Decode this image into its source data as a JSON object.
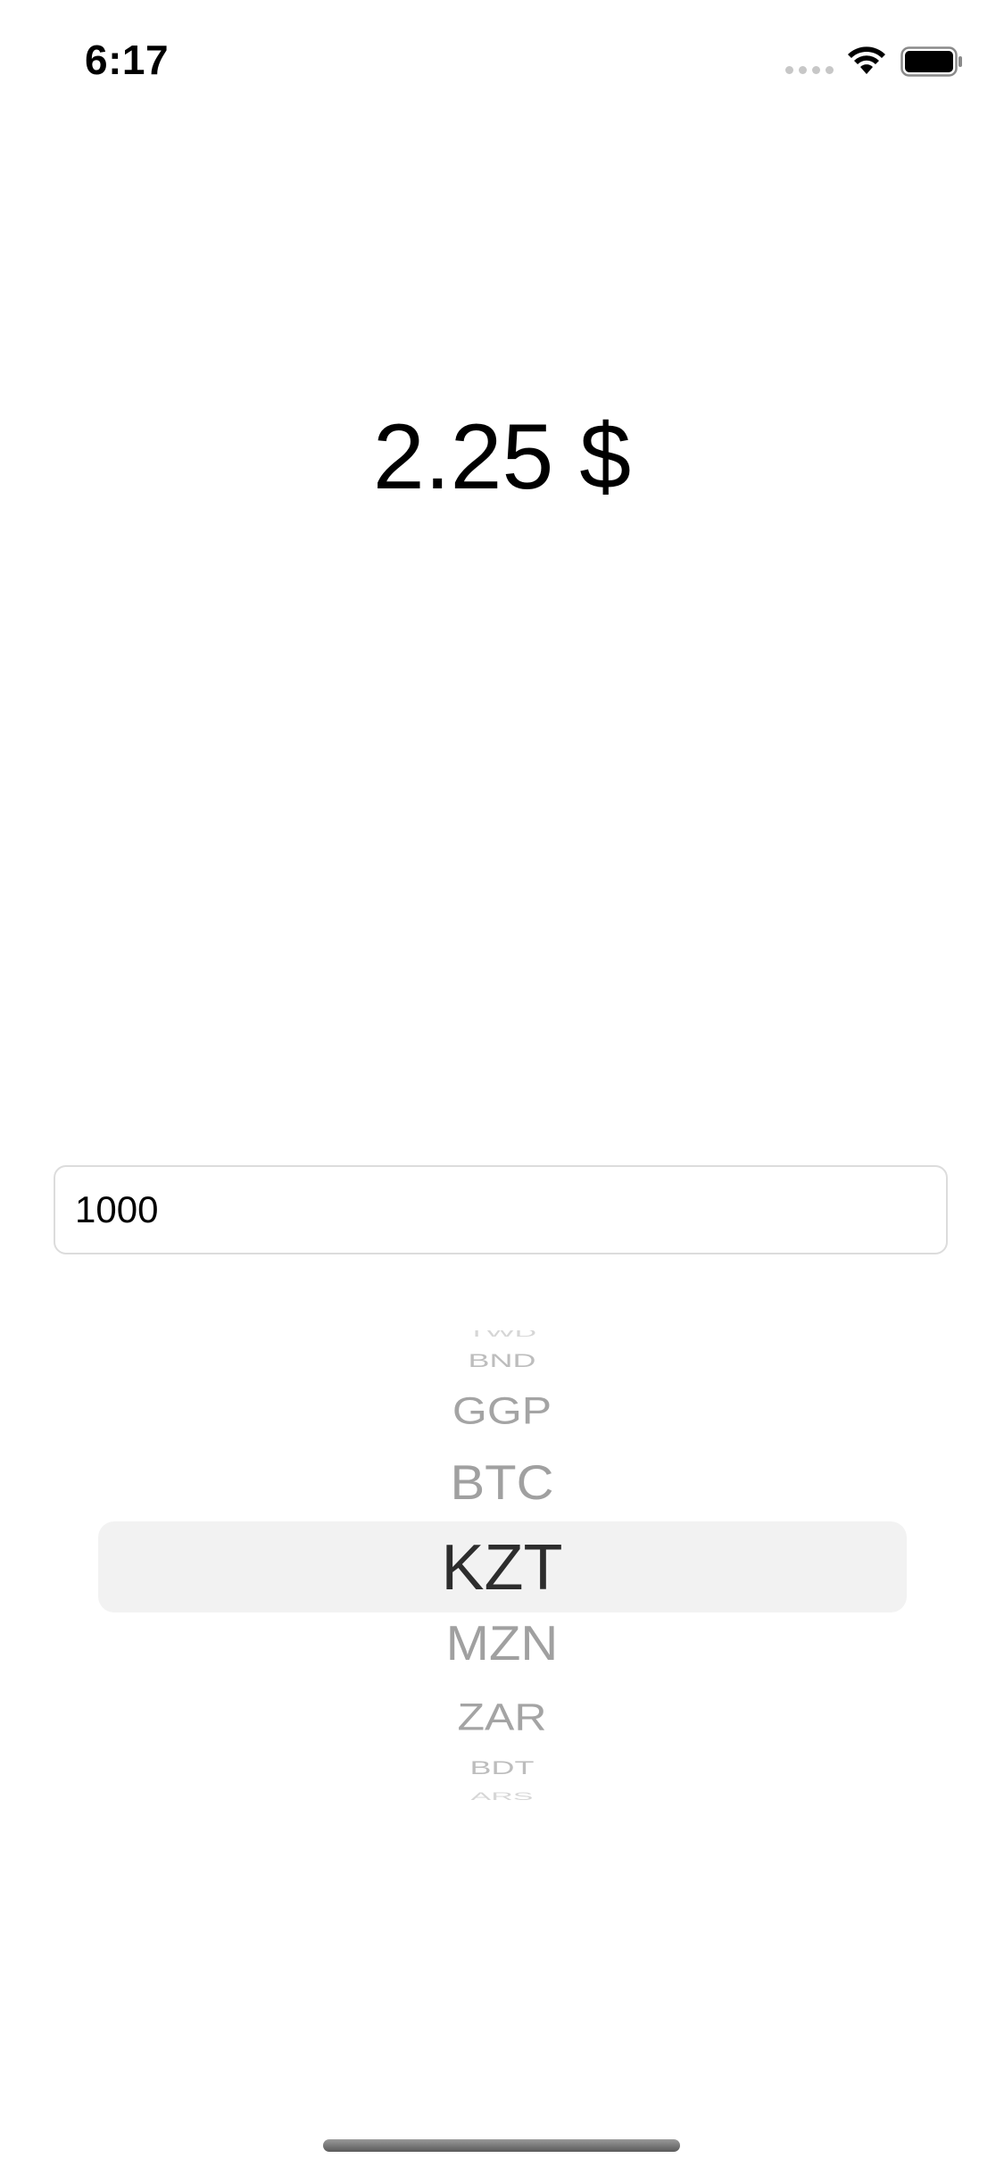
{
  "status_bar": {
    "time": "6:17",
    "icons": [
      "signal-dots-icon",
      "wifi-icon",
      "battery-icon"
    ]
  },
  "result": {
    "text": "2.25 $"
  },
  "amount_input": {
    "value": "1000"
  },
  "picker": {
    "items": [
      "TWD",
      "BND",
      "GGP",
      "BTC",
      "KZT",
      "MZN",
      "ZAR",
      "BDT",
      "ARS"
    ],
    "selected": "KZT",
    "highlight_color": "#f2f2f2"
  }
}
